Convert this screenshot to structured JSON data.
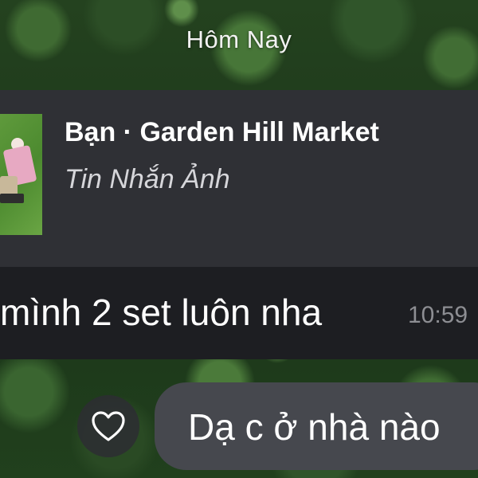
{
  "chat": {
    "date_separator": "Hôm Nay",
    "reply_preview": {
      "title": "Bạn · Garden Hill Market",
      "subtitle": "Tin Nhắn Ảnh",
      "thumbnail": "product-photo-thumbnail"
    },
    "incoming_message": {
      "text": "mình 2 set luôn nha",
      "time": "10:59"
    },
    "reaction": {
      "icon": "heart-icon"
    },
    "outgoing_message": {
      "text": "Dạ c ở nhà nào"
    }
  },
  "colors": {
    "background": "#1e3a1c",
    "reply_card": "#2f3035",
    "incoming_bubble": "#1d1e22",
    "outgoing_bubble": "#46484e",
    "time_text": "#8d8e93"
  }
}
